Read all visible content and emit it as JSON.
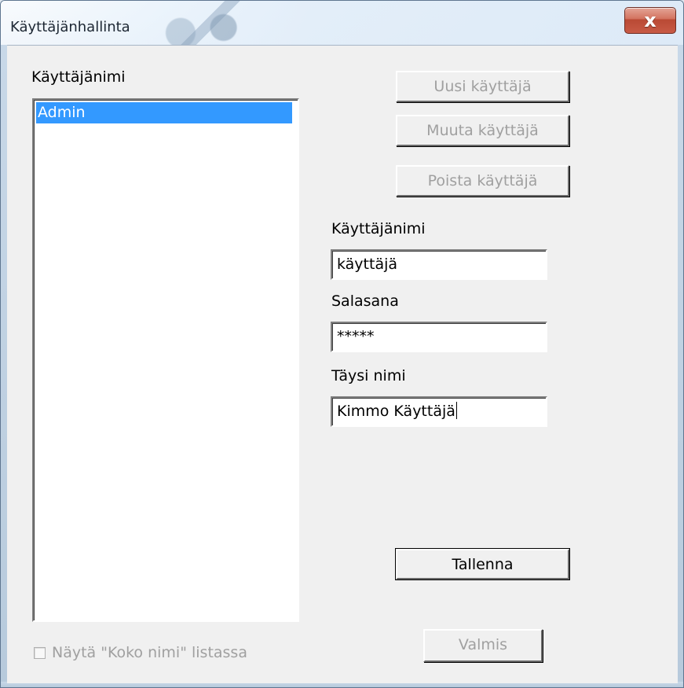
{
  "window": {
    "title": "Käyttäjänhallinta",
    "close_label": "x"
  },
  "left_panel": {
    "header": "Käyttäjänimi",
    "users": [
      {
        "label": "Admin",
        "selected": true
      }
    ]
  },
  "actions": {
    "new_user": "Uusi käyttäjä",
    "edit_user": "Muuta käyttäjä",
    "delete_user": "Poista käyttäjä"
  },
  "form": {
    "username_label": "Käyttäjänimi",
    "username_value": "käyttäjä",
    "password_label": "Salasana",
    "password_value": "*****",
    "fullname_label": "Täysi nimi",
    "fullname_value": "Kimmo Käyttäjä"
  },
  "footer": {
    "show_full_name_label": "Näytä \"Koko nimi\" listassa",
    "save_label": "Tallenna",
    "done_label": "Valmis"
  },
  "colors": {
    "selection": "#3399ff",
    "disabled_text": "#a0a0a0",
    "close_button": "#c85a45"
  }
}
